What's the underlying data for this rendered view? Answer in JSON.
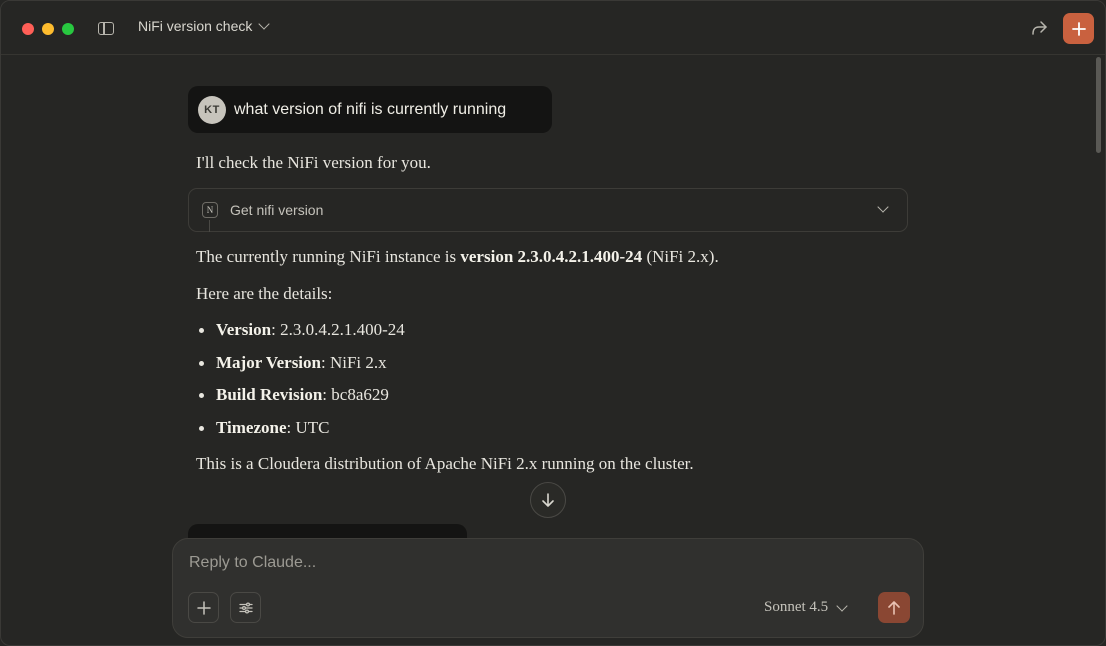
{
  "window": {
    "title": "NiFi version check",
    "accent_color": "#c9613f"
  },
  "user_message": {
    "avatar_initials": "KT",
    "text": "what version of nifi is currently running"
  },
  "assistant": {
    "intro": "I'll check the NiFi version for you.",
    "tool_call": {
      "icon_letter": "N",
      "label": "Get nifi version"
    },
    "summary_pre": "The currently running NiFi instance is ",
    "summary_bold": "version 2.3.0.4.2.1.400-24",
    "summary_post": " (NiFi 2.x).",
    "details_intro": "Here are the details:",
    "details": [
      {
        "label": "Version",
        "value": ": 2.3.0.4.2.1.400-24"
      },
      {
        "label": "Major Version",
        "value": ": NiFi 2.x"
      },
      {
        "label": "Build Revision",
        "value": ": bc8a629"
      },
      {
        "label": "Timezone",
        "value": ": UTC"
      }
    ],
    "closing": "This is a Cloudera distribution of Apache NiFi 2.x running on the cluster."
  },
  "composer": {
    "placeholder": "Reply to Claude...",
    "model": "Sonnet 4.5"
  }
}
